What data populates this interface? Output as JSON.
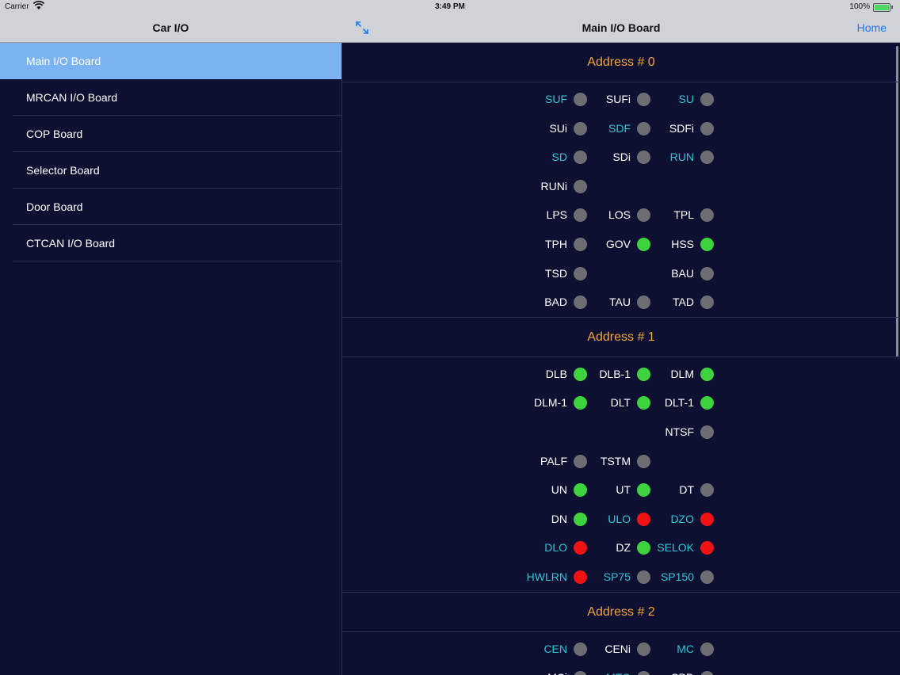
{
  "status": {
    "carrier": "Carrier",
    "time": "3:49 PM",
    "battery": "100%"
  },
  "nav": {
    "left_title": "Car I/O",
    "right_title": "Main I/O Board",
    "home_label": "Home"
  },
  "sidebar": {
    "items": [
      {
        "label": "Main I/O Board",
        "active": true
      },
      {
        "label": "MRCAN I/O Board"
      },
      {
        "label": "COP Board"
      },
      {
        "label": "Selector Board"
      },
      {
        "label": "Door Board"
      },
      {
        "label": "CTCAN I/O Board"
      }
    ]
  },
  "colors": {
    "green": "#3fd23f",
    "red": "#f01313",
    "gray": "#6e6e72",
    "cyan": "#33c4d6",
    "header": "#f2a63a"
  },
  "sections": [
    {
      "title": "Address # 0",
      "rows": [
        [
          {
            "n": "SUF",
            "c": 1,
            "s": "gray"
          },
          {
            "n": "SUFi",
            "c": 0,
            "s": "gray"
          },
          {
            "n": "SU",
            "c": 1,
            "s": "gray"
          }
        ],
        [
          {
            "n": "SUi",
            "c": 0,
            "s": "gray"
          },
          {
            "n": "SDF",
            "c": 1,
            "s": "gray"
          },
          {
            "n": "SDFi",
            "c": 0,
            "s": "gray"
          }
        ],
        [
          {
            "n": "SD",
            "c": 1,
            "s": "gray"
          },
          {
            "n": "SDi",
            "c": 0,
            "s": "gray"
          },
          {
            "n": "RUN",
            "c": 1,
            "s": "gray"
          }
        ],
        [
          {
            "n": "RUNi",
            "c": 0,
            "s": "gray"
          },
          null,
          null
        ],
        [
          {
            "n": "LPS",
            "c": 0,
            "s": "gray"
          },
          {
            "n": "LOS",
            "c": 0,
            "s": "gray"
          },
          {
            "n": "TPL",
            "c": 0,
            "s": "gray"
          }
        ],
        [
          {
            "n": "TPH",
            "c": 0,
            "s": "gray"
          },
          {
            "n": "GOV",
            "c": 0,
            "s": "green"
          },
          {
            "n": "HSS",
            "c": 0,
            "s": "green"
          }
        ],
        [
          {
            "n": "TSD",
            "c": 0,
            "s": "gray"
          },
          null,
          {
            "n": "BAU",
            "c": 0,
            "s": "gray"
          }
        ],
        [
          {
            "n": "BAD",
            "c": 0,
            "s": "gray"
          },
          {
            "n": "TAU",
            "c": 0,
            "s": "gray"
          },
          {
            "n": "TAD",
            "c": 0,
            "s": "gray"
          }
        ]
      ]
    },
    {
      "title": "Address # 1",
      "rows": [
        [
          {
            "n": "DLB",
            "c": 0,
            "s": "green"
          },
          {
            "n": "DLB-1",
            "c": 0,
            "s": "green"
          },
          {
            "n": "DLM",
            "c": 0,
            "s": "green"
          }
        ],
        [
          {
            "n": "DLM-1",
            "c": 0,
            "s": "green"
          },
          {
            "n": "DLT",
            "c": 0,
            "s": "green"
          },
          {
            "n": "DLT-1",
            "c": 0,
            "s": "green"
          }
        ],
        [
          null,
          null,
          {
            "n": "NTSF",
            "c": 0,
            "s": "gray"
          }
        ],
        [
          {
            "n": "PALF",
            "c": 0,
            "s": "gray"
          },
          {
            "n": "TSTM",
            "c": 0,
            "s": "gray"
          },
          null
        ],
        [
          {
            "n": "UN",
            "c": 0,
            "s": "green"
          },
          {
            "n": "UT",
            "c": 0,
            "s": "green"
          },
          {
            "n": "DT",
            "c": 0,
            "s": "gray"
          }
        ],
        [
          {
            "n": "DN",
            "c": 0,
            "s": "green"
          },
          {
            "n": "ULO",
            "c": 1,
            "s": "red"
          },
          {
            "n": "DZO",
            "c": 1,
            "s": "red"
          }
        ],
        [
          {
            "n": "DLO",
            "c": 1,
            "s": "red"
          },
          {
            "n": "DZ",
            "c": 0,
            "s": "green"
          },
          {
            "n": "SELOK",
            "c": 1,
            "s": "red"
          }
        ],
        [
          {
            "n": "HWLRN",
            "c": 1,
            "s": "red"
          },
          {
            "n": "SP75",
            "c": 1,
            "s": "gray"
          },
          {
            "n": "SP150",
            "c": 1,
            "s": "gray"
          }
        ]
      ]
    },
    {
      "title": "Address # 2",
      "rows": [
        [
          {
            "n": "CEN",
            "c": 1,
            "s": "gray"
          },
          {
            "n": "CENi",
            "c": 0,
            "s": "gray"
          },
          {
            "n": "MC",
            "c": 1,
            "s": "gray"
          }
        ],
        [
          {
            "n": "MCi",
            "c": 0,
            "s": "gray"
          },
          {
            "n": "MTO",
            "c": 1,
            "s": "gray"
          },
          {
            "n": "SPD",
            "c": 0,
            "s": "gray"
          }
        ]
      ]
    }
  ]
}
